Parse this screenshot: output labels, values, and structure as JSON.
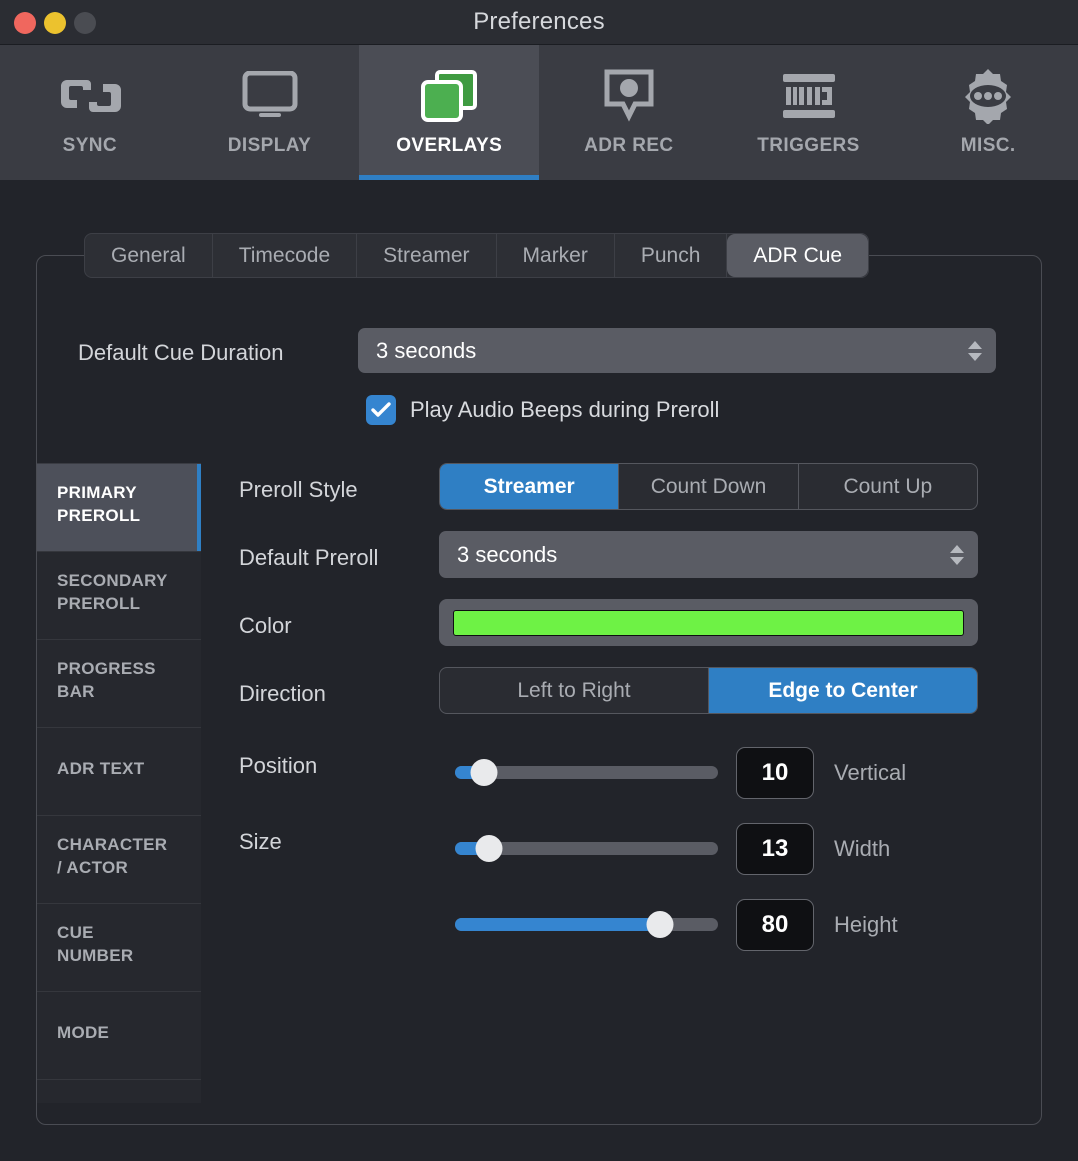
{
  "window": {
    "title": "Preferences",
    "traffic_lights": [
      "close",
      "minimize",
      "zoom"
    ]
  },
  "toolbar": {
    "items": [
      {
        "label": "SYNC",
        "icon": "sync-link-icon",
        "active": false
      },
      {
        "label": "DISPLAY",
        "icon": "monitor-icon",
        "active": false
      },
      {
        "label": "OVERLAYS",
        "icon": "layers-icon",
        "active": true
      },
      {
        "label": "ADR REC",
        "icon": "speech-bubble-record-icon",
        "active": false
      },
      {
        "label": "TRIGGERS",
        "icon": "midi-icon",
        "active": false
      },
      {
        "label": "MISC.",
        "icon": "gear-icon",
        "active": false
      }
    ],
    "accent_color": "#2f7fc4",
    "active_icon_color": "#4caf50"
  },
  "tabs": {
    "items": [
      "General",
      "Timecode",
      "Streamer",
      "Marker",
      "Punch",
      "ADR Cue"
    ],
    "active": "ADR Cue"
  },
  "cue_duration": {
    "label": "Default Cue Duration",
    "value": "3 seconds"
  },
  "audio_beeps": {
    "label": "Play Audio Beeps during Preroll",
    "checked": true,
    "checkbox_color": "#3585d0"
  },
  "sidebar": {
    "items": [
      {
        "label": "PRIMARY\nPREROLL",
        "line1": "PRIMARY",
        "line2": "PREROLL",
        "active": true
      },
      {
        "label": "SECONDARY PREROLL",
        "line1": "SECONDARY",
        "line2": "PREROLL",
        "active": false
      },
      {
        "label": "PROGRESS BAR",
        "line1": "PROGRESS",
        "line2": "BAR",
        "active": false
      },
      {
        "label": "ADR TEXT",
        "line1": "ADR TEXT",
        "line2": "",
        "active": false
      },
      {
        "label": "CHARACTER / ACTOR",
        "line1": "CHARACTER",
        "line2": "/ ACTOR",
        "active": false
      },
      {
        "label": "CUE NUMBER",
        "line1": "CUE",
        "line2": "NUMBER",
        "active": false
      },
      {
        "label": "MODE",
        "line1": "MODE",
        "line2": "",
        "active": false
      }
    ]
  },
  "preroll_style": {
    "label": "Preroll Style",
    "options": [
      "Streamer",
      "Count Down",
      "Count Up"
    ],
    "selected": "Streamer"
  },
  "default_preroll": {
    "label": "Default Preroll",
    "value": "3 seconds"
  },
  "color": {
    "label": "Color",
    "value": "#6ef245"
  },
  "direction": {
    "label": "Direction",
    "options": [
      "Left to Right",
      "Edge to Center"
    ],
    "selected": "Edge to Center"
  },
  "position": {
    "label": "Position",
    "value": "10",
    "unit": "Vertical",
    "percent": 11
  },
  "size": {
    "label": "Size",
    "width": {
      "value": "13",
      "unit": "Width",
      "percent": 13
    },
    "height": {
      "value": "80",
      "unit": "Height",
      "percent": 78
    }
  }
}
